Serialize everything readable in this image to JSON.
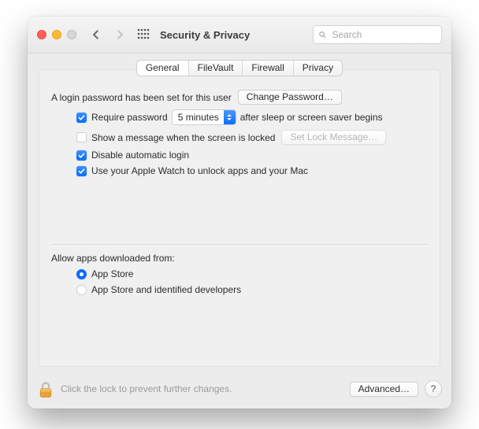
{
  "window": {
    "title": "Security & Privacy"
  },
  "search": {
    "placeholder": "Search"
  },
  "tabs": [
    {
      "label": "General",
      "selected": true
    },
    {
      "label": "FileVault",
      "selected": false
    },
    {
      "label": "Firewall",
      "selected": false
    },
    {
      "label": "Privacy",
      "selected": false
    }
  ],
  "login": {
    "intro": "A login password has been set for this user",
    "change_button": "Change Password…",
    "require_pw": {
      "label_before": "Require password",
      "delay_value": "5 minutes",
      "label_after": "after sleep or screen saver begins",
      "checked": true
    },
    "lock_msg": {
      "label": "Show a message when the screen is locked",
      "set_button": "Set Lock Message…",
      "checked": false
    },
    "disable_auto_login": {
      "label": "Disable automatic login",
      "checked": true
    },
    "apple_watch": {
      "label": "Use your Apple Watch to unlock apps and your Mac",
      "checked": true
    }
  },
  "allow_apps": {
    "heading": "Allow apps downloaded from:",
    "options": [
      {
        "label": "App Store",
        "selected": true
      },
      {
        "label": "App Store and identified developers",
        "selected": false
      }
    ]
  },
  "footer": {
    "lock_text": "Click the lock to prevent further changes.",
    "advanced_button": "Advanced…",
    "help": "?"
  },
  "icons": {
    "search": "search-icon",
    "back": "chevron-left-icon",
    "forward": "chevron-right-icon",
    "apps": "apps-grid-icon",
    "lock": "lock-icon"
  }
}
